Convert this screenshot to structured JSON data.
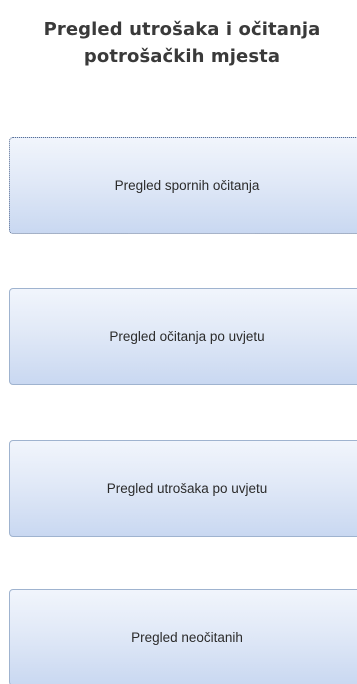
{
  "header": {
    "title_line1": "Pregled utrošaka i očitanja",
    "title_line2": "potrošačkih mjesta"
  },
  "buttons": [
    {
      "label": "Pregled spornih očitanja",
      "focused": true
    },
    {
      "label": "Pregled očitanja po uvjetu",
      "focused": false
    },
    {
      "label": "Pregled utrošaka po uvjetu",
      "focused": false
    },
    {
      "label": "Pregled neočitanih",
      "focused": false
    }
  ]
}
